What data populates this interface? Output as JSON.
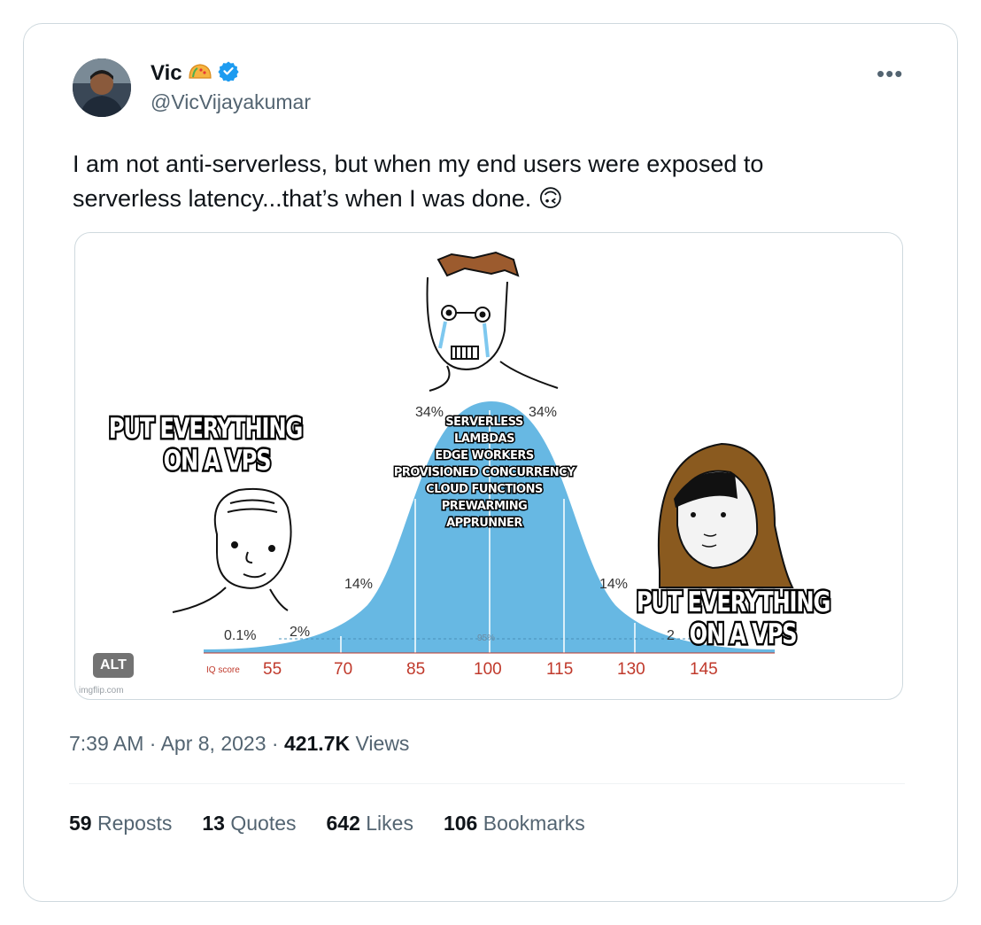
{
  "author": {
    "name": "Vic",
    "handle": "@VicVijayakumar",
    "verified": true,
    "emoji": "taco"
  },
  "tweet": {
    "text": "I am not anti-serverless, but when my end users were exposed to serverless latency...that’s when I was done. 🙃"
  },
  "meme": {
    "left_caption_line1": "PUT EVERYTHING",
    "left_caption_line2": "ON A VPS",
    "right_caption_line1": "PUT EVERYTHING",
    "right_caption_line2": "ON A VPS",
    "center_list": [
      "SERVERLESS",
      "LAMBDAS",
      "EDGE WORKERS",
      "PROVISIONED CONCURRENCY",
      "CLOUD FUNCTIONS",
      "PREWARMING",
      "APPRUNNER"
    ],
    "percentages": {
      "p01": "0.1%",
      "p2": "2%",
      "p14_left": "14%",
      "p34_left": "34%",
      "p34_right": "34%",
      "p14_right": "14%",
      "p2_right": "2",
      "p95": "95%"
    },
    "iq_label": "IQ score",
    "iq_ticks": [
      "55",
      "70",
      "85",
      "100",
      "115",
      "130",
      "145"
    ],
    "alt_badge": "ALT",
    "watermark": "imgflip.com",
    "curve_color": "#67b8e3"
  },
  "meta": {
    "time": "7:39 AM",
    "date": "Apr 8, 2023",
    "views_count": "421.7K",
    "views_label": "Views"
  },
  "stats": {
    "reposts_count": "59",
    "reposts_label": "Reposts",
    "quotes_count": "13",
    "quotes_label": "Quotes",
    "likes_count": "642",
    "likes_label": "Likes",
    "bookmarks_count": "106",
    "bookmarks_label": "Bookmarks"
  },
  "colors": {
    "secondary_text": "#536471",
    "verified_blue": "#1d9bf0",
    "border": "#cfd9de"
  }
}
